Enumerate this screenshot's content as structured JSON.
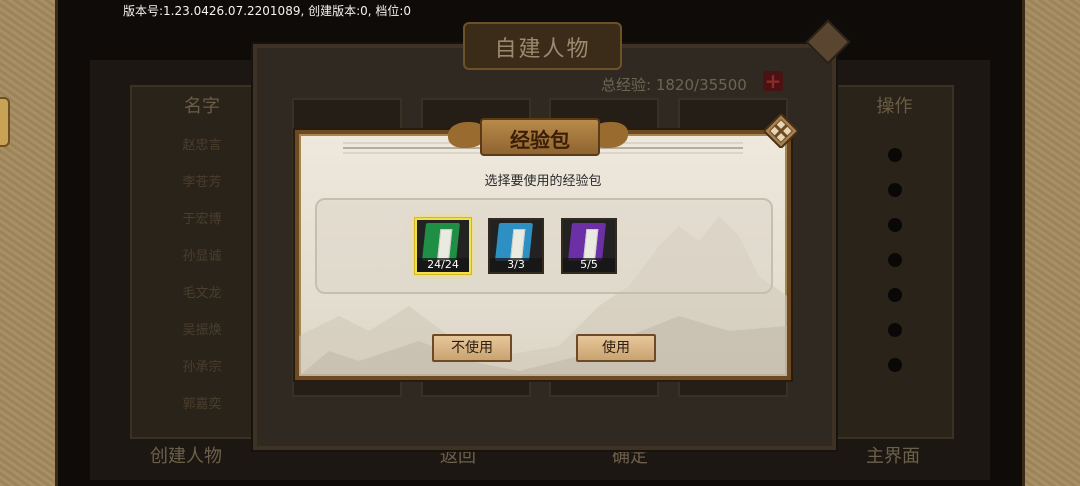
{
  "version_text": "版本号:1.23.0426.07.2201089, 创建版本:0, 档位:0",
  "background": {
    "title": "自建人物",
    "exp_total_label": "总经验:",
    "exp_total_value": "1820/35500",
    "list_header": "名字",
    "names": [
      "赵忠言",
      "李苍芳",
      "于宏博",
      "孙显诚",
      "毛文龙",
      "吴振焕",
      "孙承宗",
      "郭嘉奕"
    ],
    "ops_header": "操作",
    "bottom": [
      "创建人物",
      "返回",
      "确定",
      "主界面"
    ]
  },
  "dialog": {
    "title": "经验包",
    "subtitle": "选择要使用的经验包",
    "items": [
      {
        "name": "经验书",
        "count": "24/24",
        "color": "#1f8f45",
        "selected": true
      },
      {
        "name": "经验书",
        "count": "3/3",
        "color": "#2e8fc2",
        "selected": false
      },
      {
        "name": "经验书",
        "count": "5/5",
        "color": "#6d2fa6",
        "selected": false
      }
    ],
    "cancel_label": "不使用",
    "use_label": "使用"
  },
  "colors": {
    "accent_gold": "#c9a371",
    "selected_border": "#f1e24a",
    "plus_red": "#8b2a2a"
  }
}
